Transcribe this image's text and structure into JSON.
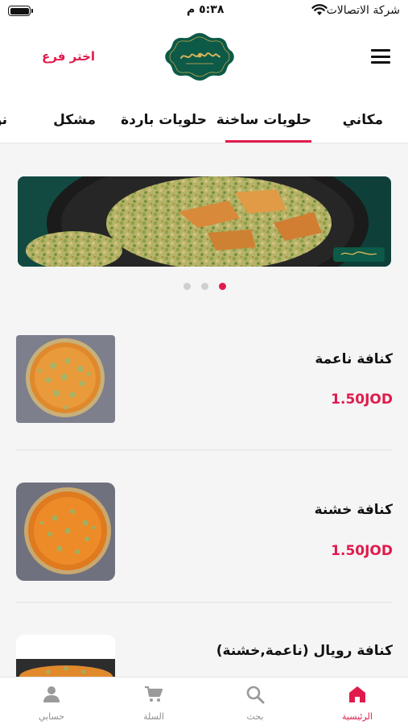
{
  "status_bar": {
    "carrier": "شركة الاتصالات",
    "time": "٥:٣٨ م"
  },
  "header": {
    "branch_label": "اختر فرع",
    "menu_icon": "hamburger-menu-icon",
    "logo": "brand-logo"
  },
  "tabs": [
    {
      "label": "مكاني",
      "active": false
    },
    {
      "label": "حلويات ساخنة",
      "active": true
    },
    {
      "label": "حلويات باردة",
      "active": false
    },
    {
      "label": "مشكل",
      "active": false
    },
    {
      "label": "نو",
      "active": false
    }
  ],
  "carousel": {
    "slides": 3,
    "active_index": 0
  },
  "products": [
    {
      "name": "كنافة ناعمة",
      "price": "1.50JOD"
    },
    {
      "name": "كنافة خشنة",
      "price": "1.50JOD"
    },
    {
      "name": "كنافة رويال (ناعمة,خشنة)",
      "price": ""
    }
  ],
  "bottom_nav": [
    {
      "label": "الرئيسية",
      "icon": "home-icon",
      "active": true
    },
    {
      "label": "بحث",
      "icon": "search-icon",
      "active": false
    },
    {
      "label": "السلة",
      "icon": "cart-icon",
      "active": false
    },
    {
      "label": "حسابي",
      "icon": "user-icon",
      "active": false
    }
  ],
  "colors": {
    "accent": "#e01b4c",
    "brand_green": "#0c5a47",
    "background": "#f5f5f6"
  }
}
